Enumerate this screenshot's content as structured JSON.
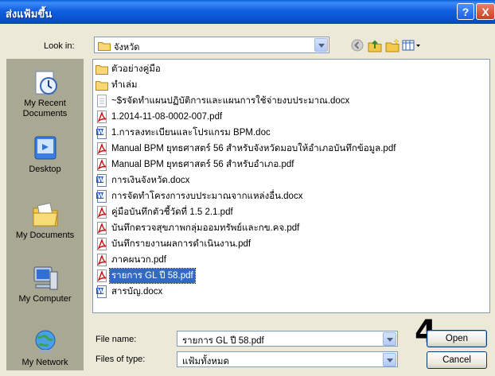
{
  "window": {
    "title": "ส่งแฟ้มขึ้น",
    "help_label": "?",
    "close_label": "X"
  },
  "lookin": {
    "label": "Look in:",
    "value": "จังหวัด"
  },
  "places": [
    {
      "id": "recent",
      "label": "My Recent Documents",
      "icon": "recent-documents-icon"
    },
    {
      "id": "desktop",
      "label": "Desktop",
      "icon": "desktop-icon"
    },
    {
      "id": "mydocs",
      "label": "My Documents",
      "icon": "my-documents-icon"
    },
    {
      "id": "computer",
      "label": "My Computer",
      "icon": "my-computer-icon"
    },
    {
      "id": "network",
      "label": "My Network",
      "icon": "my-network-icon"
    }
  ],
  "files": [
    {
      "name": "ตัวอย่างคู่มือ",
      "type": "folder"
    },
    {
      "name": "ทำเล่ม",
      "type": "folder"
    },
    {
      "name": "~$รจัดทำแผนปฏิบัติการและแผนการใช้จ่ายงบประมาณ.docx",
      "type": "temp"
    },
    {
      "name": "1.2014-11-08-0002-007.pdf",
      "type": "pdf"
    },
    {
      "name": "1.การลงทะเบียนและโปรแกรม BPM.doc",
      "type": "doc"
    },
    {
      "name": "Manual BPM ยุทธศาสตร์ 56 สำหรับจังหวัดมอบให้อำเภอบันทึกข้อมูล.pdf",
      "type": "pdf"
    },
    {
      "name": "Manual BPM ยุทธศาสตร์ 56 สำหรับอำเภอ.pdf",
      "type": "pdf"
    },
    {
      "name": "การเงินจังหวัด.docx",
      "type": "doc"
    },
    {
      "name": "การจัดทำโครงการงบประมาณจากแหล่งอื่น.docx",
      "type": "doc"
    },
    {
      "name": "คู่มือบันทึกตัวชี้วัดที่ 1.5 2.1.pdf",
      "type": "pdf"
    },
    {
      "name": "บันทึกตรวจสุขภาพกลุ่มออมทรัพย์และกข.คจ.pdf",
      "type": "pdf"
    },
    {
      "name": "บันทึกรายงานผลการดำเนินงาน.pdf",
      "type": "pdf"
    },
    {
      "name": "ภาคผนวก.pdf",
      "type": "pdf"
    },
    {
      "name": "รายการ GL ปี 58.pdf",
      "type": "pdf",
      "selected": true
    },
    {
      "name": "สารบัญ.docx",
      "type": "doc"
    }
  ],
  "filename": {
    "label": "File name:",
    "value": "รายการ GL ปี 58.pdf"
  },
  "filetype": {
    "label": "Files of type:",
    "value": "แฟ้มทั้งหมด"
  },
  "buttons": {
    "open": "Open",
    "cancel": "Cancel"
  },
  "step_marker": "4"
}
